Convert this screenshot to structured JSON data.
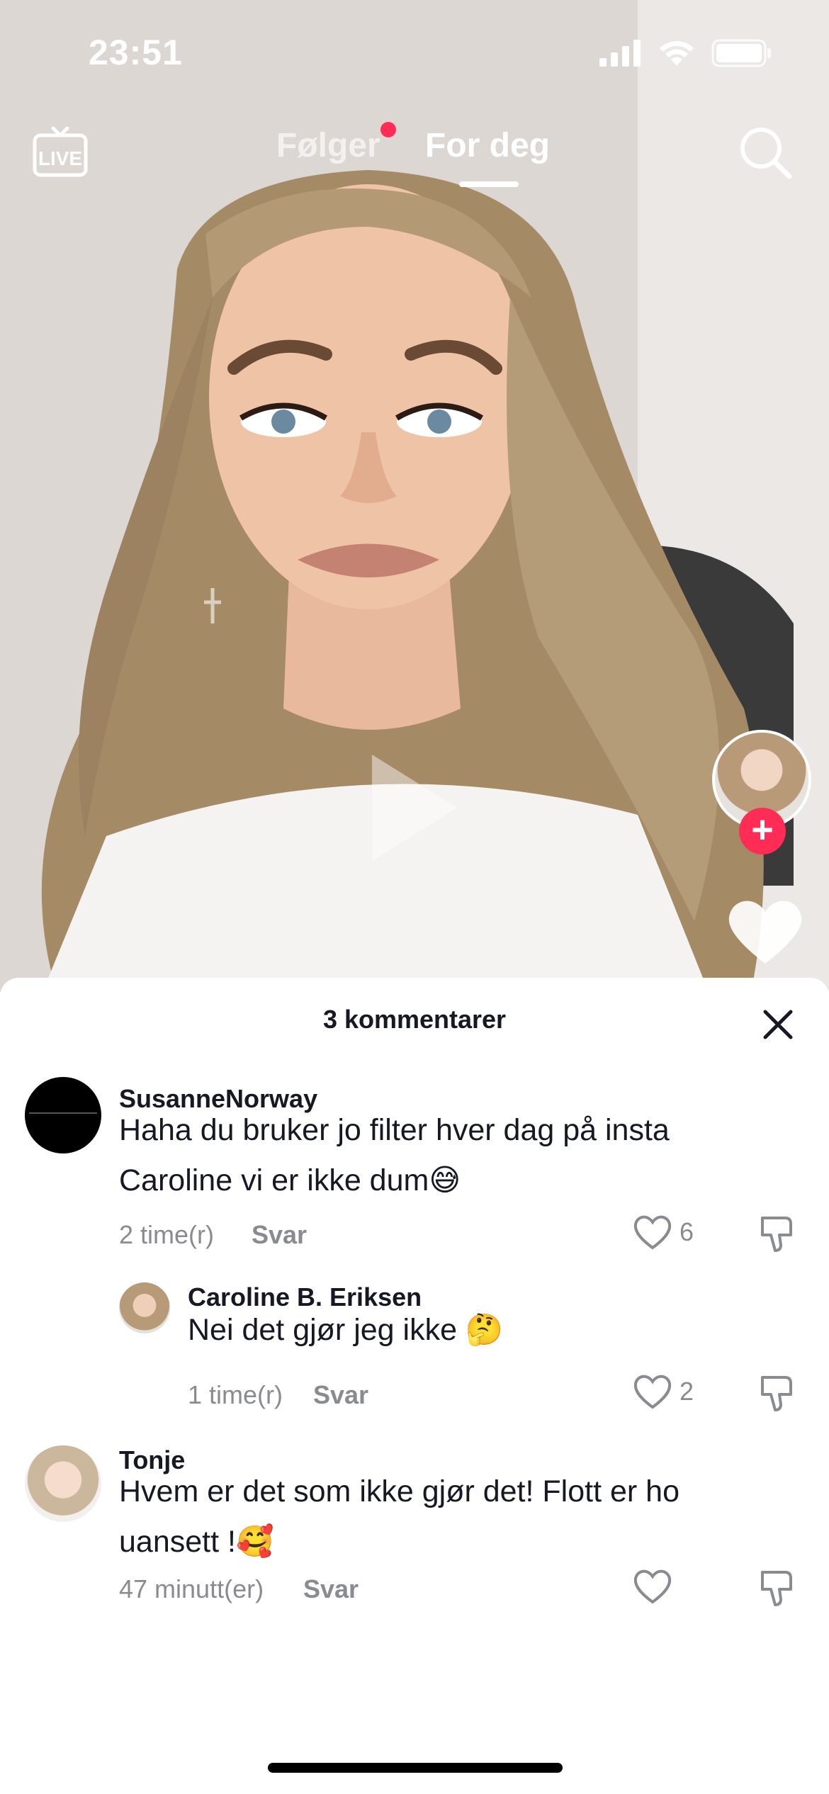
{
  "status_bar": {
    "time": "23:51"
  },
  "top_nav": {
    "live_label": "LIVE",
    "tab_following": "Følger",
    "tab_for_you": "For deg"
  },
  "comments_sheet": {
    "title": "3 kommentarer",
    "comments": [
      {
        "username": "SusanneNorway",
        "text": "Haha du bruker jo filter hver dag på insta Caroline vi er ikke dum😅",
        "time": "2 time(r)",
        "reply_label": "Svar",
        "likes": "6"
      },
      {
        "username": "Caroline B. Eriksen",
        "text": "Nei det gjør jeg ikke 🤔",
        "time": "1 time(r)",
        "reply_label": "Svar",
        "likes": "2"
      },
      {
        "username": "Tonje",
        "text": "Hvem er det som ikke gjør det! Flott er ho uansett !🥰",
        "time": "47 minutt(er)",
        "reply_label": "Svar",
        "likes": ""
      }
    ]
  },
  "colors": {
    "accent": "#ff2c55",
    "text": "#161823",
    "muted": "#8a8b91"
  }
}
